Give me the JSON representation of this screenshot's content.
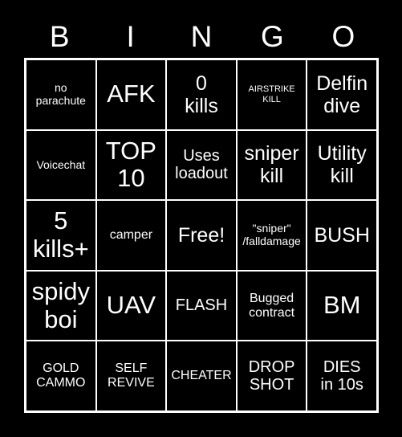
{
  "card": {
    "title": "BINGO",
    "background_color": "#000000",
    "text_color": "#ffffff",
    "border_color": "#ffffff",
    "header_letters": [
      "B",
      "I",
      "N",
      "G",
      "O"
    ],
    "rows": 5,
    "columns": 5,
    "cells": [
      {
        "text": "no\nparachute",
        "size": "s-sm",
        "free": false
      },
      {
        "text": "AFK",
        "size": "s-xxl",
        "free": false
      },
      {
        "text": "0\nkills",
        "size": "s-xl",
        "free": false
      },
      {
        "text": "AIRSTRIKE\nKILL",
        "size": "s-xs",
        "free": false
      },
      {
        "text": "Delfin\ndive",
        "size": "s-xl",
        "free": false
      },
      {
        "text": "Voicechat",
        "size": "s-sm",
        "free": false
      },
      {
        "text": "TOP\n10",
        "size": "s-xxl",
        "free": false
      },
      {
        "text": "Uses\nloadout",
        "size": "s-lg",
        "free": false
      },
      {
        "text": "sniper\nkill",
        "size": "s-xl",
        "free": false
      },
      {
        "text": "Utility\nkill",
        "size": "s-xl",
        "free": false
      },
      {
        "text": "5\nkills+",
        "size": "s-xxl",
        "free": false
      },
      {
        "text": "camper",
        "size": "s-md",
        "free": false
      },
      {
        "text": "Free!",
        "size": "s-xl",
        "free": true
      },
      {
        "text": "\"sniper\"\n/falldamage",
        "size": "s-sm",
        "free": false
      },
      {
        "text": "BUSH",
        "size": "s-xl",
        "free": false
      },
      {
        "text": "spidy\nboi",
        "size": "s-xxl",
        "free": false
      },
      {
        "text": "UAV",
        "size": "s-xxl",
        "free": false
      },
      {
        "text": "FLASH",
        "size": "s-lg",
        "free": false
      },
      {
        "text": "Bugged\ncontract",
        "size": "s-md",
        "free": false
      },
      {
        "text": "BM",
        "size": "s-xxl",
        "free": false
      },
      {
        "text": "GOLD\nCAMMO",
        "size": "s-md",
        "free": false
      },
      {
        "text": "SELF\nREVIVE",
        "size": "s-md",
        "free": false
      },
      {
        "text": "CHEATER",
        "size": "s-md",
        "free": false
      },
      {
        "text": "DROP\nSHOT",
        "size": "s-lg",
        "free": false
      },
      {
        "text": "DIES\nin 10s",
        "size": "s-lg",
        "free": false
      }
    ]
  }
}
